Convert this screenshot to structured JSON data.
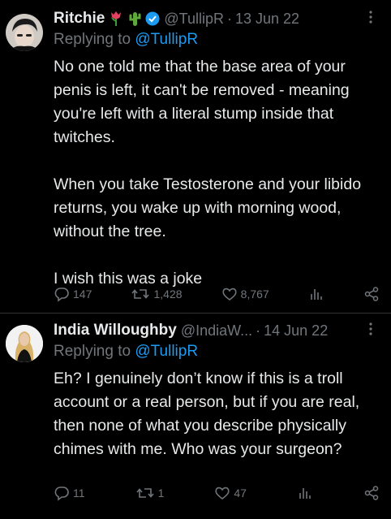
{
  "tweets": [
    {
      "name": "Ritchie",
      "handle": "@TullipR",
      "dot": "·",
      "date": "13 Jun 22",
      "replying_prefix": "Replying to ",
      "replying_to": "@TullipR",
      "text": "No one told me that the base area of your penis is left, it can't be removed - meaning you're left with a literal stump inside that twitches.\n\nWhen you take Testosterone and your libido returns, you wake up with morning wood, without the tree.\n\nI wish this was a joke",
      "replies": "147",
      "retweets": "1,428",
      "likes": "8,767",
      "emoji": [
        "tulip",
        "cactus"
      ],
      "verified": true
    },
    {
      "name": "India Willoughby",
      "handle": "@IndiaW...",
      "dot": "·",
      "date": "14 Jun 22",
      "replying_prefix": "Replying to ",
      "replying_to": "@TullipR",
      "text": "Eh? I genuinely don’t know if this is a troll account or a real person, but if you are real, then none of what you describe physically chimes with me. Who was your surgeon?",
      "replies": "11",
      "retweets": "1",
      "likes": "47"
    }
  ],
  "colors": {
    "background": "#000000",
    "text": "#e7e9ea",
    "muted": "#71767b",
    "accent": "#1d9bf0"
  },
  "icons": [
    "reply-icon",
    "retweet-icon",
    "like-icon",
    "analytics-icon",
    "share-icon",
    "more-icon",
    "verified-icon",
    "tulip-icon",
    "cactus-icon"
  ]
}
